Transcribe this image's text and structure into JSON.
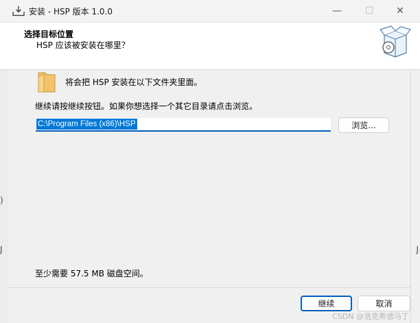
{
  "window": {
    "title": "安装 - HSP 版本 1.0.0",
    "min_glyph": "—",
    "max_glyph": "☐",
    "close_glyph": "✕"
  },
  "header": {
    "title": "选择目标位置",
    "subtitle": "HSP 应该被安装在哪里？"
  },
  "body": {
    "install_note": "将会把 HSP 安装在以下文件夹里面。",
    "continue_note": "继续请按继续按钮。如果你想选择一个其它目录请点击浏览。",
    "path_value": "C:\\Program Files (x86)\\HSP",
    "browse_label": "浏览...",
    "disk_requirement": "至少需要 57.5 MB 磁盘空间。"
  },
  "footer": {
    "next_label": "继续",
    "cancel_label": "取消"
  },
  "background": {
    "left_mark_1": ")",
    "left_mark_2": "J",
    "right_mark": "J"
  },
  "watermark": "CSDN @浩克希德马丁",
  "colors": {
    "accent": "#005fb8",
    "selection": "#0078d7",
    "folder": "#f2c36b"
  }
}
